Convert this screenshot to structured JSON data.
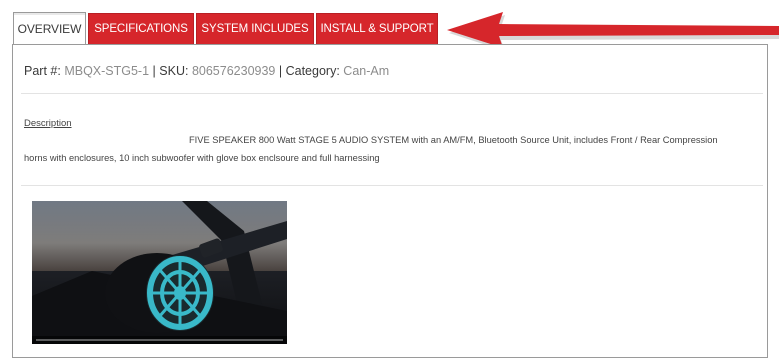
{
  "tabs": [
    {
      "label": "OVERVIEW",
      "active": true
    },
    {
      "label": "SPECIFICATIONS",
      "active": false
    },
    {
      "label": "SYSTEM INCLUDES",
      "active": false
    },
    {
      "label": "INSTALL & SUPPORT",
      "active": false
    }
  ],
  "product": {
    "part_label": "Part #:",
    "part_value": "MBQX-STG5-1",
    "sku_label": "SKU:",
    "sku_value": "806576230939",
    "category_label": "Category:",
    "category_value": "Can-Am",
    "separator": "|"
  },
  "description": {
    "heading": "Description",
    "line1": "FIVE SPEAKER 800 Watt STAGE 5 AUDIO SYSTEM with an AM/FM, Bluetooth Source Unit, includes Front / Rear Compression",
    "line2": "horns with enclosures, 10 inch subwoofer with glove box enclsoure and full harnessing"
  },
  "video": {
    "progress": 0.0
  },
  "colors": {
    "tab_red": "#d6262b",
    "arrow_red": "#d6262b",
    "value_gray": "#8c8c8c",
    "speaker_cyan": "#39b9c9"
  }
}
